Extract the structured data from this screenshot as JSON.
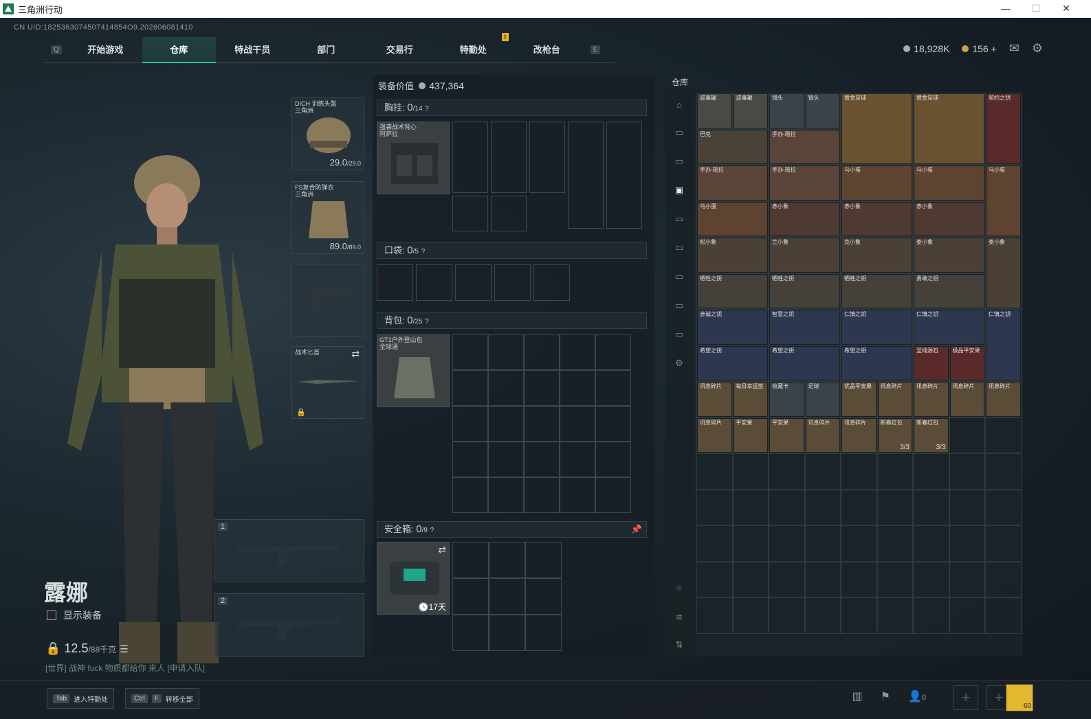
{
  "window": {
    "title": "三角洲行动",
    "controls": [
      "—",
      "☐",
      "✕"
    ]
  },
  "uid": "CN UID:1825363074507414854O9.202606081410",
  "nav": {
    "left_key": "Q",
    "right_key": "E",
    "tabs": [
      "开始游戏",
      "仓库",
      "特战干员",
      "部门",
      "交易行",
      "特勤处",
      "改枪台"
    ],
    "active_tab": "仓库",
    "badge_tab": "特勤处"
  },
  "currency": {
    "silver": "18,928K",
    "gold": "156",
    "gold_plus": "+"
  },
  "loadout": {
    "helmet": {
      "label1": "DICH 训练头盔",
      "label2": "三角洲",
      "durability": "29.0",
      "max": "/29.0"
    },
    "armor": {
      "label1": "FS复合防弹衣",
      "label2": "三角洲",
      "durability": "89.0",
      "max": "/89.0"
    },
    "melee": {
      "label": "战术匕首"
    },
    "slot1": "1",
    "slot2": "2"
  },
  "operator": {
    "name": "露娜",
    "show_equip": "显示装备",
    "weight": "12.5",
    "weight_max": "/88千克"
  },
  "chat": "[世界] 战神 fuck 物质都给你 来人 [申请入队]",
  "equipment": {
    "title": "装备价值",
    "value": "437,364",
    "chest": {
      "label": "胸挂:",
      "count": "0",
      "cap": "/14",
      "item1": "强袭战术背心",
      "item2": "阿萨拉"
    },
    "pocket": {
      "label": "口袋:",
      "count": "0",
      "cap": "/5"
    },
    "backpack": {
      "label": "背包:",
      "count": "0",
      "cap": "/25",
      "item1": "GT1户外登山包",
      "item2": "全球通"
    },
    "safebox": {
      "label": "安全箱:",
      "count": "0",
      "cap": "/9",
      "timer": "17天"
    }
  },
  "warehouse": {
    "title": "仓库",
    "items": [
      {
        "label": "滤毒罐",
        "color": "#4a4a44"
      },
      {
        "label": "滤毒罐",
        "color": "#4a4a44"
      },
      {
        "label": "镜头",
        "color": "#3b4348"
      },
      {
        "label": "镜头",
        "color": "#3b4348"
      },
      {
        "label": "黄金足球",
        "color": "#6a5230"
      },
      {
        "label": "黄金足球",
        "color": "#6a5230"
      },
      {
        "label": "契约之钥",
        "color": "#5a2a2a"
      },
      {
        "label": "巴克",
        "color": "#4a4138"
      },
      {
        "label": "手办-瑶拉",
        "color": "#5a4438"
      },
      {
        "label": "手办-瑶拉",
        "color": "#5a4438"
      },
      {
        "label": "手办-瑶拉",
        "color": "#5a4438"
      },
      {
        "label": "乌小蛋",
        "color": "#5e4330"
      },
      {
        "label": "乌小蛋",
        "color": "#5e4330"
      },
      {
        "label": "乌小蛋",
        "color": "#5e4330"
      },
      {
        "label": "乌小蛋",
        "color": "#5e4330"
      },
      {
        "label": "赤小象",
        "color": "#4f3a32"
      },
      {
        "label": "赤小象",
        "color": "#4f3a32"
      },
      {
        "label": "赤小象",
        "color": "#4f3a32"
      },
      {
        "label": "松小象",
        "color": "#4a4036"
      },
      {
        "label": "兰小象",
        "color": "#4a4036"
      },
      {
        "label": "克小象",
        "color": "#4a4036"
      },
      {
        "label": "麦小象",
        "color": "#4a4036"
      },
      {
        "label": "麦小象",
        "color": "#4a4036"
      },
      {
        "label": "牺牲之钥",
        "color": "#46403a"
      },
      {
        "label": "牺牲之钥",
        "color": "#46403a"
      },
      {
        "label": "牺牲之钥",
        "color": "#46403a"
      },
      {
        "label": "勇敢之钥",
        "color": "#46403a"
      },
      {
        "label": "赤诚之钥",
        "color": "#2e3750"
      },
      {
        "label": "智慧之钥",
        "color": "#2e3750"
      },
      {
        "label": "仁慎之钥",
        "color": "#2e3750"
      },
      {
        "label": "仁慎之钥",
        "color": "#2e3750"
      },
      {
        "label": "仁慎之钥",
        "color": "#2e3750"
      },
      {
        "label": "希望之钥",
        "color": "#2e3750"
      },
      {
        "label": "希望之钥",
        "color": "#2e3750"
      },
      {
        "label": "希望之钥",
        "color": "#2e3750"
      },
      {
        "label": "至纯源石",
        "color": "#5a2a2a"
      },
      {
        "label": "极品平安果",
        "color": "#5a2a2a"
      },
      {
        "label": "讯息碎片",
        "color": "#5a4c36"
      },
      {
        "label": "每日幸运签",
        "color": "#5a4c36"
      },
      {
        "label": "收藏卡",
        "color": "#3b4348"
      },
      {
        "label": "足球",
        "color": "#3b4348"
      },
      {
        "label": "优品平安果",
        "color": "#5a4c36"
      },
      {
        "label": "讯息碎片",
        "color": "#5a4c36"
      },
      {
        "label": "讯息碎片",
        "color": "#5a4c36"
      },
      {
        "label": "讯息碎片",
        "color": "#5a4c36"
      },
      {
        "label": "讯息碎片",
        "color": "#5a4c36"
      },
      {
        "label": "讯息碎片",
        "color": "#5a4c36"
      },
      {
        "label": "平安果",
        "color": "#5a4c36"
      },
      {
        "label": "平安果",
        "color": "#5a4c36"
      },
      {
        "label": "讯息碎片",
        "color": "#5a4c36"
      },
      {
        "label": "讯息碎片",
        "color": "#5a4c36"
      },
      {
        "label": "新春红包",
        "color": "#5a4c36",
        "count": "3/3"
      },
      {
        "label": "新春红包",
        "color": "#5a4c36",
        "count": "3/3"
      }
    ]
  },
  "bottom": {
    "tab_key": "Tab",
    "tab_label": "进入特勤处",
    "ctrl_key": "Ctrl",
    "f_key": "F",
    "ctrl_label": "转移全部",
    "friends": "0",
    "level": "60"
  }
}
